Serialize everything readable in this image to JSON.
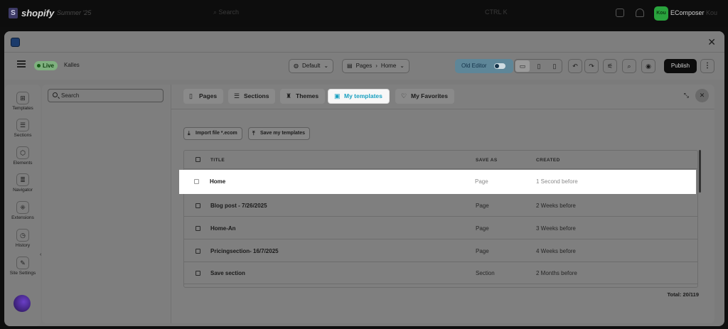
{
  "shopify": {
    "logo_text": "shopify",
    "edition": "Summer '25",
    "search_placeholder": "Search",
    "shortcut": "CTRL K",
    "store_badge": "Kou",
    "app_name": "EComposer",
    "user_extra": "Kou"
  },
  "toolbar": {
    "live_label": "Live",
    "store_name": "Kalles",
    "theme_select": "Default",
    "page_breadcrumb_parent": "Pages",
    "page_breadcrumb_current": "Home",
    "old_editor_label": "Old Editor",
    "publish_label": "Publish"
  },
  "rail": {
    "items": [
      {
        "label": "Templates",
        "icon": "templates-icon"
      },
      {
        "label": "Sections",
        "icon": "sections-icon"
      },
      {
        "label": "Elements",
        "icon": "elements-icon"
      },
      {
        "label": "Navigator",
        "icon": "navigator-icon"
      },
      {
        "label": "Extensions",
        "icon": "extensions-icon"
      },
      {
        "label": "History",
        "icon": "history-icon"
      },
      {
        "label": "Site Settings",
        "icon": "site-settings-icon"
      }
    ]
  },
  "panel": {
    "search_placeholder": "Search",
    "tabs": [
      {
        "label": "Pages"
      },
      {
        "label": "Sections"
      },
      {
        "label": "Themes"
      },
      {
        "label": "My templates"
      },
      {
        "label": "My Favorites"
      }
    ],
    "active_tab": "My templates",
    "import_label": "Import file *.ecom",
    "save_label": "Save my templates",
    "columns": {
      "title": "TITLE",
      "save_as": "SAVE AS",
      "created": "CREATED"
    },
    "rows": [
      {
        "title": "Home",
        "save_as": "Page",
        "created": "1 Second before"
      },
      {
        "title": "Blog post - 7/26/2025",
        "save_as": "Page",
        "created": "2 Weeks before"
      },
      {
        "title": "Home-An",
        "save_as": "Page",
        "created": "3 Weeks before"
      },
      {
        "title": "Pricingsection- 16/7/2025",
        "save_as": "Page",
        "created": "4 Weeks before"
      },
      {
        "title": "Save section",
        "save_as": "Section",
        "created": "2 Months before"
      }
    ],
    "total": "Total: 20/119"
  },
  "colors": {
    "active_tab_text": "#1aa0c0",
    "live_badge": "#7fb07f",
    "shopify_badge": "#29a33d",
    "publish_bg": "#0d0d0d"
  }
}
